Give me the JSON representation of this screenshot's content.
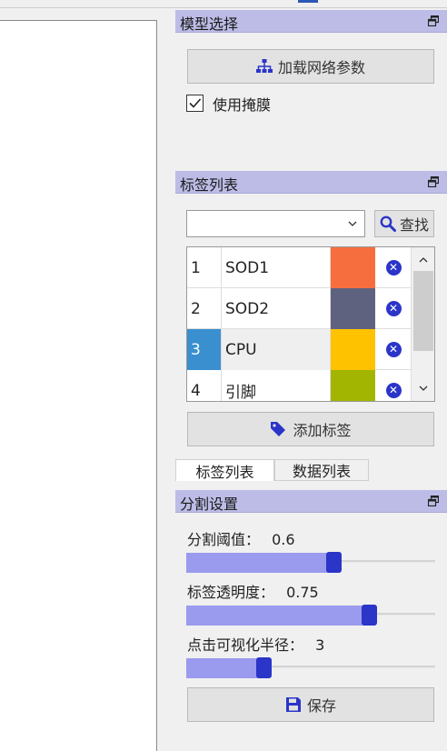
{
  "model_panel": {
    "title": "模型选择",
    "load_button_label": "加载网络参数",
    "use_mask_label": "使用掩膜",
    "use_mask_checked": true
  },
  "label_panel": {
    "title": "标签列表",
    "combo_value": "",
    "find_button_label": "查找",
    "rows": [
      {
        "index": "1",
        "name": "SOD1",
        "color": "#f76e3e"
      },
      {
        "index": "2",
        "name": "SOD2",
        "color": "#5f627f"
      },
      {
        "index": "3",
        "name": "CPU",
        "color": "#ffc200"
      },
      {
        "index": "4",
        "name": "引脚",
        "color": "#a2b500"
      }
    ],
    "selected_row": 2,
    "add_label_button": "添加标签"
  },
  "tabs": [
    {
      "label": "标签列表",
      "active": true
    },
    {
      "label": "数据列表",
      "active": false
    }
  ],
  "segment_panel": {
    "title": "分割设置",
    "threshold": {
      "label": "分割阈值：",
      "value": "0.6",
      "fraction": 0.6
    },
    "opacity": {
      "label": "标签透明度：",
      "value": "0.75",
      "fraction": 0.75
    },
    "click_radius": {
      "label": "点击可视化半径：",
      "value": "3",
      "fraction": 0.3
    },
    "save_button_label": "保存"
  },
  "colors": {
    "accent": "#2b35c8",
    "panel_header": "#bcbce6",
    "slider_fill": "#9a9aee"
  },
  "icons": {
    "float": "float-window-icon",
    "network": "network-icon",
    "search": "search-icon",
    "tag": "tag-icon",
    "save": "save-icon",
    "delete": "delete-circle-icon"
  }
}
